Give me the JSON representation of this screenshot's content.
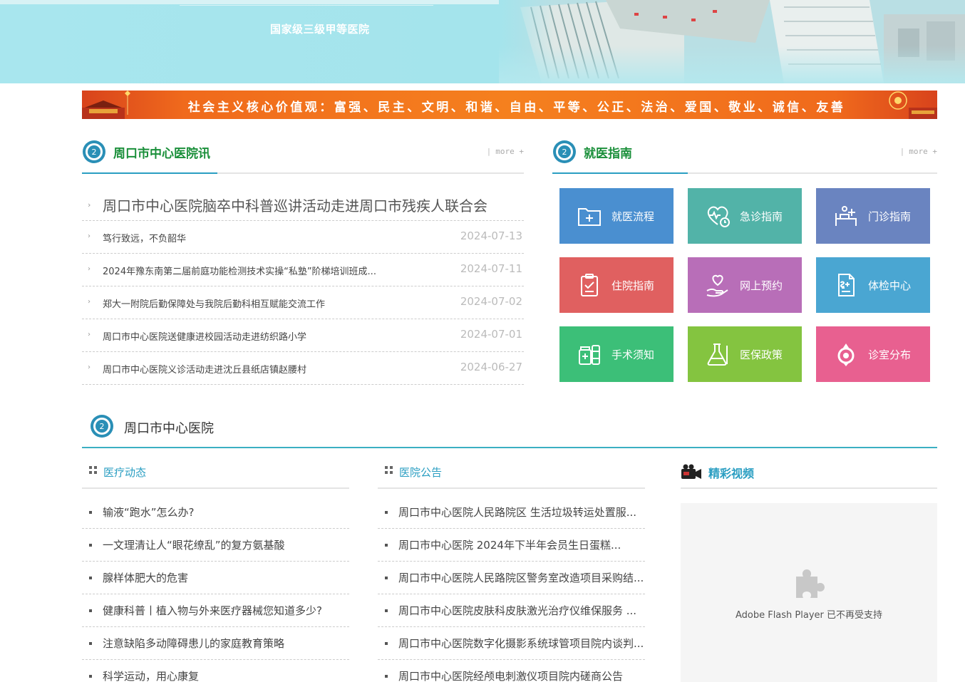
{
  "header": {
    "tagline": "国家级三级甲等医院"
  },
  "slogan": {
    "text": "社会主义核心价值观：富强、民主、文明、和谐、自由、平等、公正、法治、爱国、敬业、诚信、友善"
  },
  "news_section": {
    "title": "周口市中心医院讯",
    "more": "more +",
    "headline": "周口市中心医院脑卒中科普巡讲活动走进周口市残疾人联合会",
    "items": [
      {
        "title": "笃行致远，不负韶华",
        "date": "2024-07-13"
      },
      {
        "title": "2024年豫东南第二届前庭功能检测技术实操“私塾”阶梯培训班成...",
        "date": "2024-07-11"
      },
      {
        "title": "郑大一附院后勤保障处与我院后勤科相互赋能交流工作",
        "date": "2024-07-02"
      },
      {
        "title": "周口市中心医院送健康进校园活动走进纺织路小学",
        "date": "2024-07-01"
      },
      {
        "title": "周口市中心医院义诊活动走进沈丘县纸店镇赵腰村",
        "date": "2024-06-27"
      }
    ]
  },
  "guide_section": {
    "title": "就医指南",
    "more": "more +",
    "tiles": [
      {
        "label": "就医流程",
        "icon": "folder-plus-icon",
        "color": "#4a8fd0"
      },
      {
        "label": "急诊指南",
        "icon": "heart-pulse-clock-icon",
        "color": "#52b3a8"
      },
      {
        "label": "门诊指南",
        "icon": "doctor-bed-icon",
        "color": "#6a84c0"
      },
      {
        "label": "住院指南",
        "icon": "clipboard-check-icon",
        "color": "#e06060"
      },
      {
        "label": "网上预约",
        "icon": "hand-heart-icon",
        "color": "#b86eb8"
      },
      {
        "label": "体检中心",
        "icon": "medical-report-icon",
        "color": "#4aa6d2"
      },
      {
        "label": "手术须知",
        "icon": "medicine-bottle-icon",
        "color": "#3cbf78"
      },
      {
        "label": "医保政策",
        "icon": "flask-icon",
        "color": "#84c440"
      },
      {
        "label": "诊室分布",
        "icon": "location-pin-icon",
        "color": "#e86090"
      }
    ]
  },
  "main_section": {
    "title": "周口市中心医院"
  },
  "medical_news": {
    "title": "医疗动态",
    "items": [
      "输液“跑水”怎么办?",
      "一文理清让人“眼花缭乱”的复方氨基酸",
      "腺样体肥大的危害",
      "健康科普丨植入物与外来医疗器械您知道多少?",
      "注意缺陷多动障碍患儿的家庭教育策略",
      "科学运动，用心康复"
    ]
  },
  "announcements": {
    "title": "医院公告",
    "items": [
      "周口市中心医院人民路院区 生活垃圾转运处置服...",
      "周口市中心医院 2024年下半年会员生日蛋糕...",
      "周口市中心医院人民路院区警务室改造项目采购结...",
      "周口市中心医院皮肤科皮肤激光治疗仪维保服务 ...",
      "周口市中心医院数字化摄影系统球管项目院内谈判...",
      "周口市中心医院经颅电刺激仪项目院内磋商公告"
    ]
  },
  "video": {
    "title": "精彩视频",
    "message": "Adobe Flash Player 已不再受支持"
  }
}
